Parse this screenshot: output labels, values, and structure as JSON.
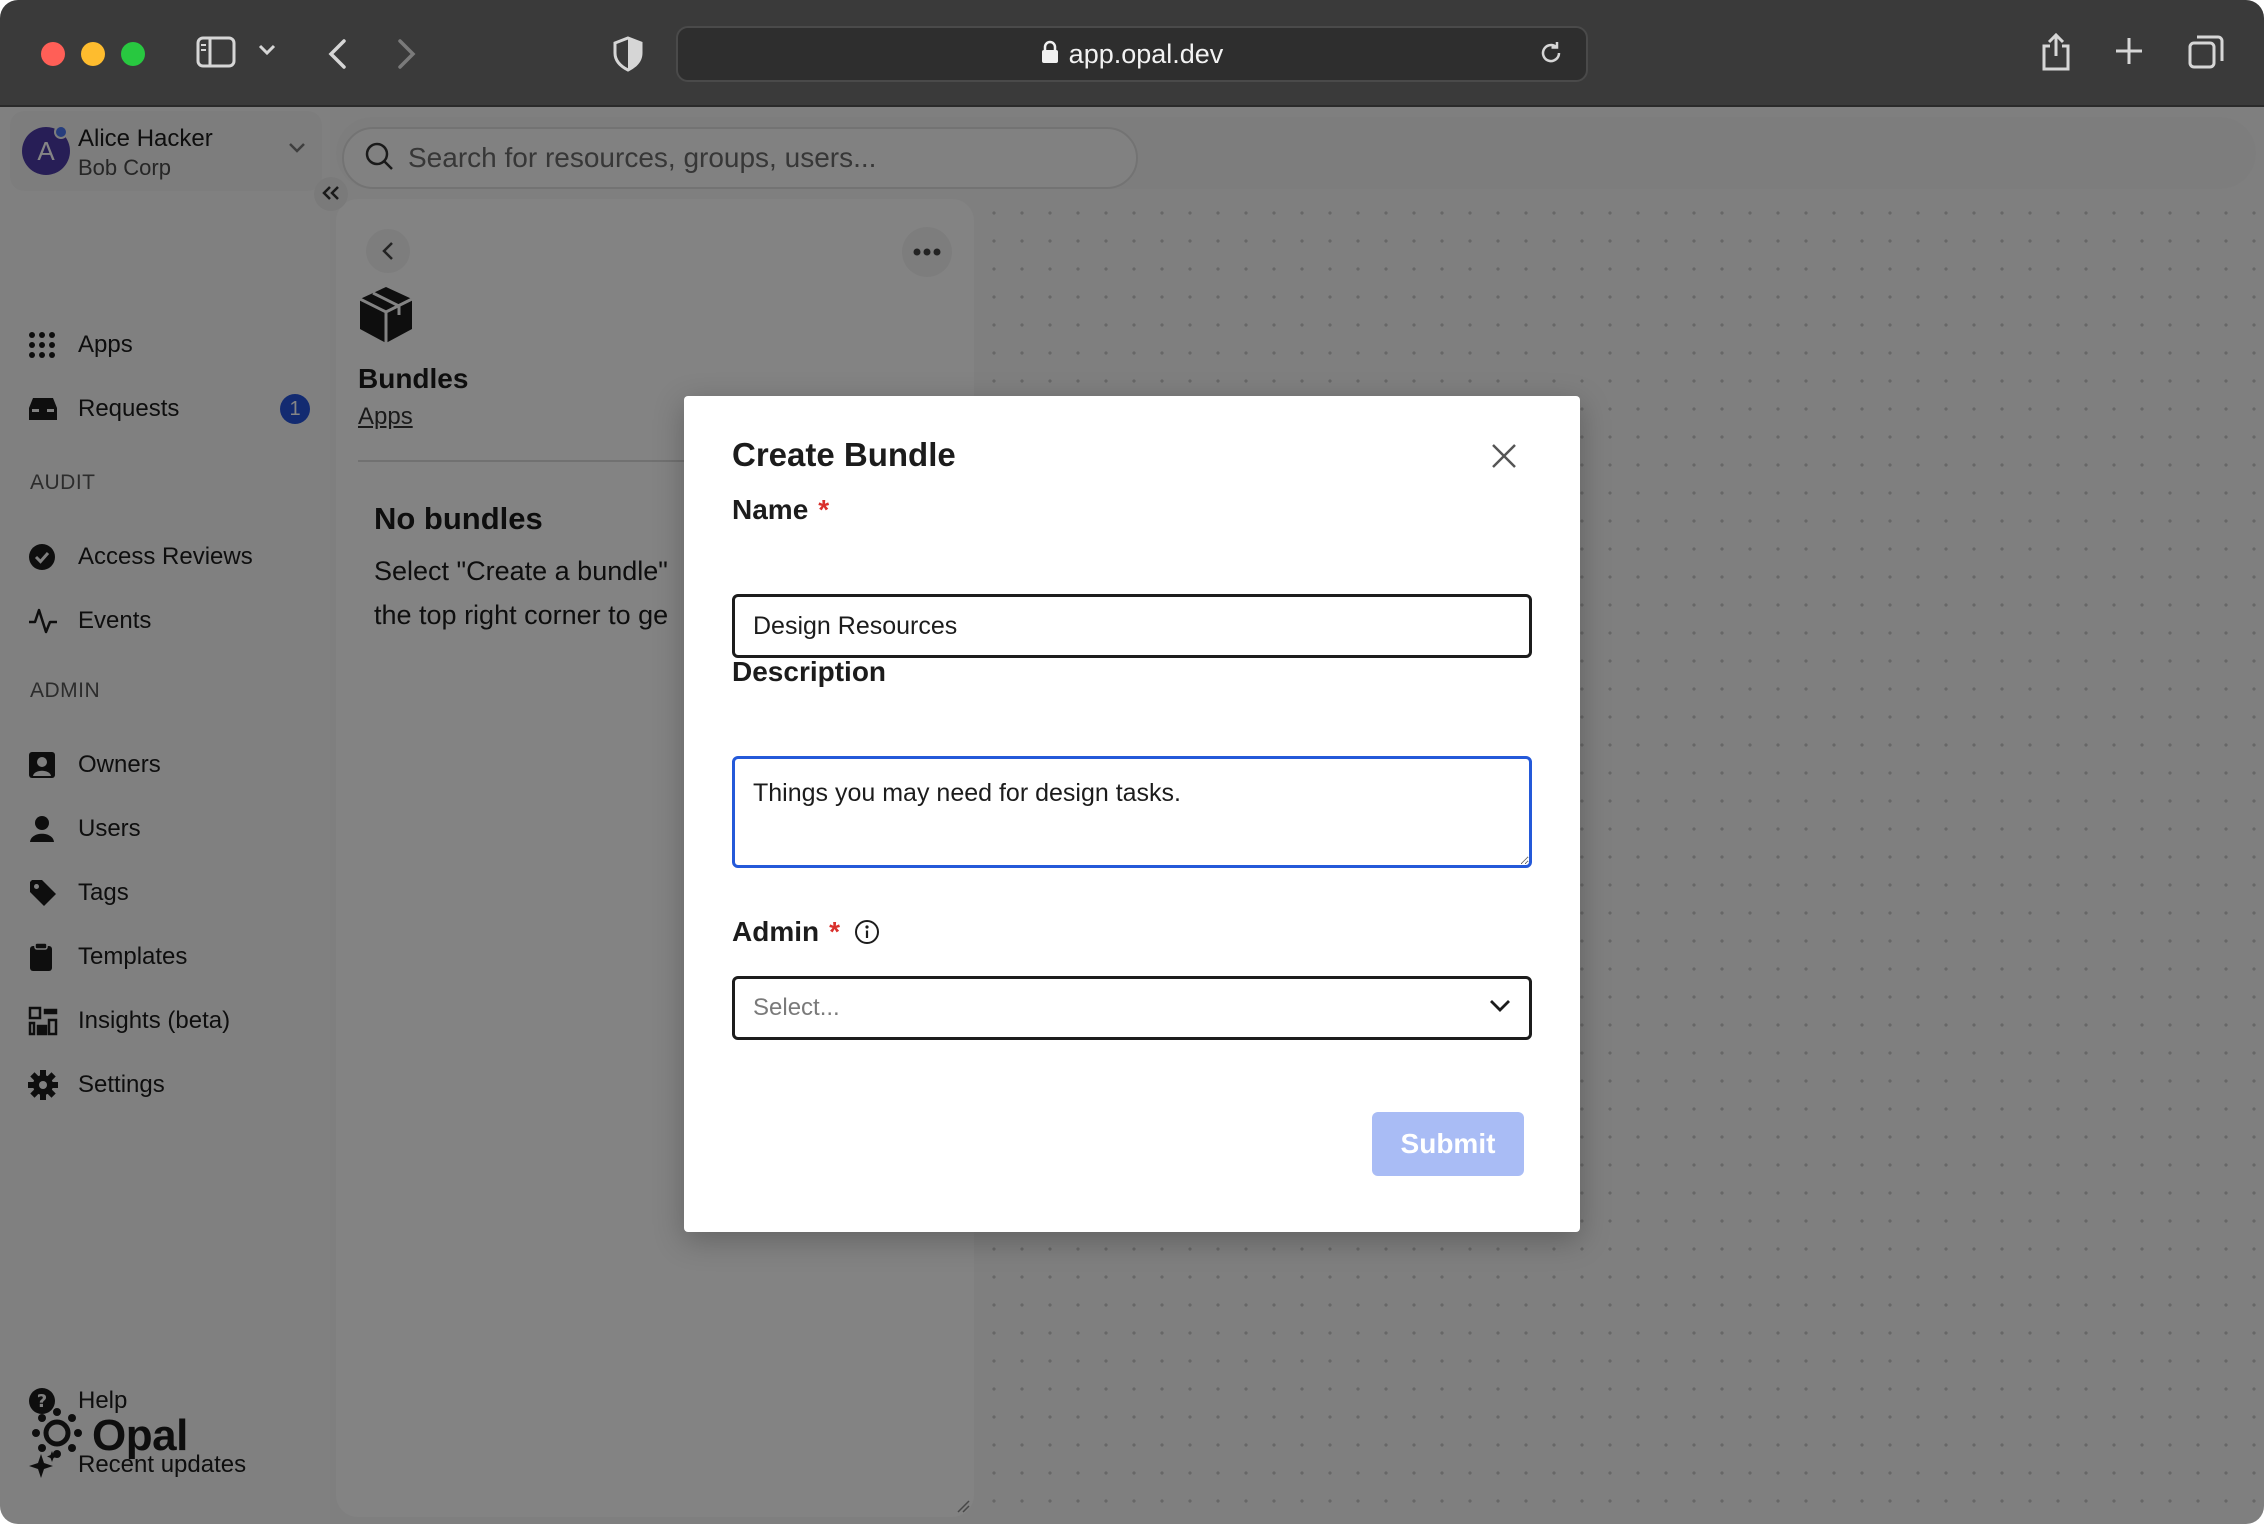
{
  "browser": {
    "url": "app.opal.dev"
  },
  "account": {
    "avatar_letter": "A",
    "name": "Alice Hacker",
    "org": "Bob Corp"
  },
  "search": {
    "placeholder": "Search for resources, groups, users..."
  },
  "sidebar": {
    "items_top": [
      {
        "label": "Apps",
        "icon": "grid-icon"
      },
      {
        "label": "Requests",
        "icon": "inbox-icon",
        "badge": "1"
      }
    ],
    "audit_heading": "AUDIT",
    "audit_items": [
      {
        "label": "Access Reviews",
        "icon": "check-circle-icon"
      },
      {
        "label": "Events",
        "icon": "activity-icon"
      }
    ],
    "admin_heading": "ADMIN",
    "admin_items": [
      {
        "label": "Owners",
        "icon": "owner-icon"
      },
      {
        "label": "Users",
        "icon": "user-icon"
      },
      {
        "label": "Tags",
        "icon": "tag-icon"
      },
      {
        "label": "Templates",
        "icon": "clipboard-icon"
      },
      {
        "label": "Insights (beta)",
        "icon": "insights-icon"
      },
      {
        "label": "Settings",
        "icon": "gear-icon"
      }
    ],
    "bottom_items": [
      {
        "label": "Help",
        "icon": "help-icon"
      },
      {
        "label": "Recent updates",
        "icon": "sparkle-icon"
      }
    ],
    "logo_text": "Opal"
  },
  "panel": {
    "title": "Bundles",
    "breadcrumb": "Apps",
    "empty_title": "No bundles",
    "empty_body_line1": "Select \"Create a bundle\"",
    "empty_body_line2": "the top right corner to ge"
  },
  "modal": {
    "title": "Create Bundle",
    "name_label": "Name",
    "name_value": "Design Resources",
    "description_label": "Description",
    "description_value": "Things you may need for design tasks.",
    "admin_label": "Admin",
    "required_mark": "*",
    "admin_placeholder": "Select...",
    "submit_label": "Submit"
  },
  "colors": {
    "accent": "#2459d9",
    "badge": "#2553d8",
    "required": "#d9302c",
    "submit_disabled": "#a9bcf5"
  }
}
